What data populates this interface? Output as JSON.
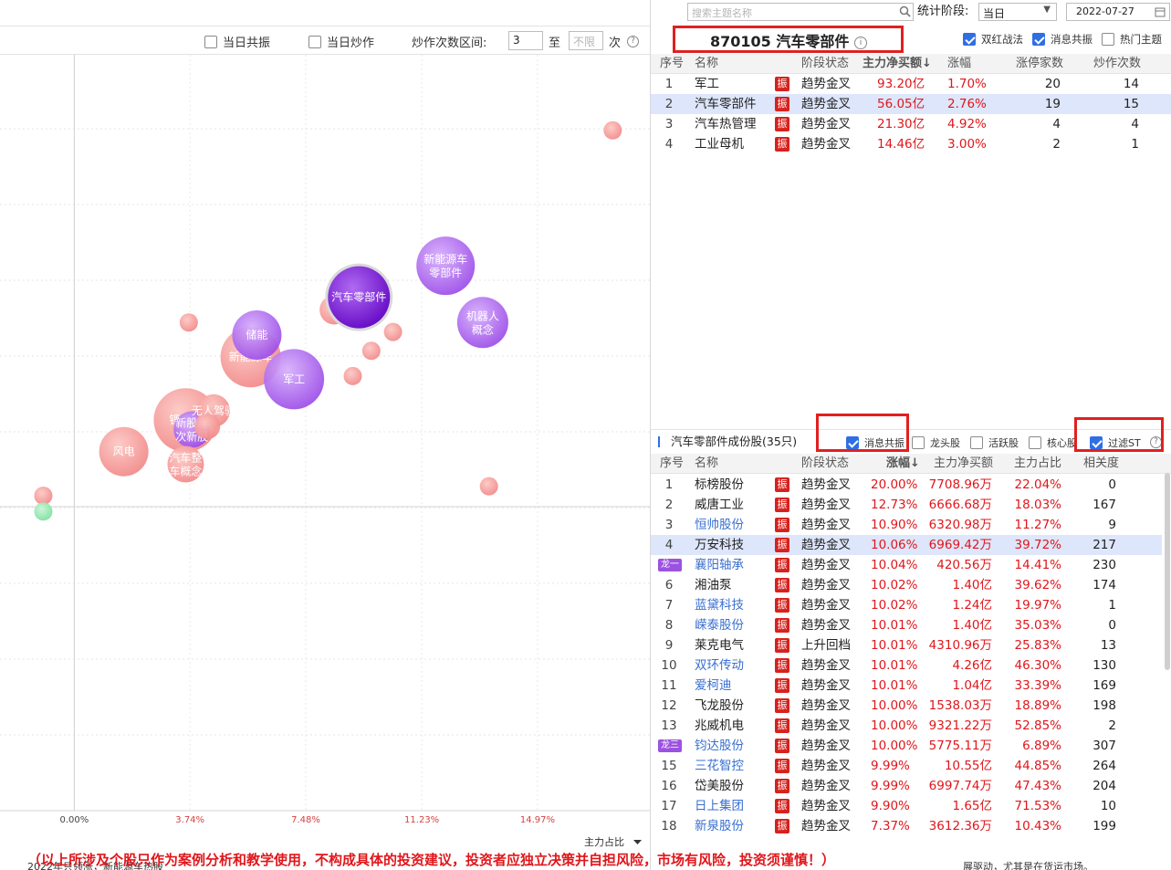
{
  "left_toolbar": {
    "resonance_label": "当日共振",
    "hype_label": "当日炒作",
    "range_label": "炒作次数区间:",
    "range_from": "3",
    "to_label": "至",
    "range_to_placeholder": "不限",
    "unit": "次"
  },
  "search": {
    "placeholder": "搜索主题名称"
  },
  "period": {
    "label": "统计阶段:",
    "value": "当日",
    "date": "2022-07-27"
  },
  "theme_title": "870105 汽车零部件",
  "filters": {
    "shuanghong": "双红战法",
    "xiaoxi": "消息共振",
    "hot": "热门主题"
  },
  "theme_table": {
    "headers": [
      "序号",
      "名称",
      "阶段状态",
      "主力净买额↓",
      "涨幅",
      "涨停家数",
      "炒作次数"
    ],
    "rows": [
      {
        "no": "1",
        "name": "军工",
        "tag": "振",
        "state": "趋势金叉",
        "net": "93.20亿",
        "chg": "1.70%",
        "limit": "20",
        "times": "14"
      },
      {
        "no": "2",
        "name": "汽车零部件",
        "tag": "振",
        "state": "趋势金叉",
        "net": "56.05亿",
        "chg": "2.76%",
        "limit": "19",
        "times": "15"
      },
      {
        "no": "3",
        "name": "汽车热管理",
        "tag": "振",
        "state": "趋势金叉",
        "net": "21.30亿",
        "chg": "4.92%",
        "limit": "4",
        "times": "4"
      },
      {
        "no": "4",
        "name": "工业母机",
        "tag": "振",
        "state": "趋势金叉",
        "net": "14.46亿",
        "chg": "3.00%",
        "limit": "2",
        "times": "1"
      }
    ]
  },
  "stock_section": {
    "title": "汽车零部件成份股(35只)",
    "filters": {
      "xiaoxi": "消息共振",
      "longtou": "龙头股",
      "huoyue": "活跃股",
      "hexin": "核心股",
      "st": "过滤ST"
    },
    "headers": [
      "序号",
      "名称",
      "阶段状态",
      "涨幅↓",
      "主力净买额",
      "主力占比",
      "相关度"
    ]
  },
  "stock_rows": [
    {
      "no": "1",
      "name": "标榜股份",
      "link": false,
      "state": "趋势金叉",
      "chg": "20.00%",
      "net": "7708.96万",
      "ratio": "22.04%",
      "rel": "0"
    },
    {
      "no": "2",
      "name": "威唐工业",
      "link": false,
      "state": "趋势金叉",
      "chg": "12.73%",
      "net": "6666.68万",
      "ratio": "18.03%",
      "rel": "167"
    },
    {
      "no": "3",
      "name": "恒帅股份",
      "link": true,
      "state": "趋势金叉",
      "chg": "10.90%",
      "net": "6320.98万",
      "ratio": "11.27%",
      "rel": "9"
    },
    {
      "no": "4",
      "name": "万安科技",
      "link": false,
      "state": "趋势金叉",
      "chg": "10.06%",
      "net": "6969.42万",
      "ratio": "39.72%",
      "rel": "217",
      "sel": true
    },
    {
      "no": "",
      "badge": "龙一",
      "name": "襄阳轴承",
      "link": true,
      "state": "趋势金叉",
      "chg": "10.04%",
      "net": "420.56万",
      "ratio": "14.41%",
      "rel": "230"
    },
    {
      "no": "6",
      "name": "湘油泵",
      "link": false,
      "state": "趋势金叉",
      "chg": "10.02%",
      "net": "1.40亿",
      "ratio": "39.62%",
      "rel": "174"
    },
    {
      "no": "7",
      "name": "蓝黛科技",
      "link": true,
      "state": "趋势金叉",
      "chg": "10.02%",
      "net": "1.24亿",
      "ratio": "19.97%",
      "rel": "1"
    },
    {
      "no": "8",
      "name": "嵘泰股份",
      "link": true,
      "state": "趋势金叉",
      "chg": "10.01%",
      "net": "1.40亿",
      "ratio": "35.03%",
      "rel": "0"
    },
    {
      "no": "9",
      "name": "莱克电气",
      "link": false,
      "state": "上升回档",
      "chg": "10.01%",
      "net": "4310.96万",
      "ratio": "25.83%",
      "rel": "13"
    },
    {
      "no": "10",
      "name": "双环传动",
      "link": true,
      "state": "趋势金叉",
      "chg": "10.01%",
      "net": "4.26亿",
      "ratio": "46.30%",
      "rel": "130"
    },
    {
      "no": "11",
      "name": "爱柯迪",
      "link": true,
      "state": "趋势金叉",
      "chg": "10.01%",
      "net": "1.04亿",
      "ratio": "33.39%",
      "rel": "169"
    },
    {
      "no": "12",
      "name": "飞龙股份",
      "link": false,
      "state": "趋势金叉",
      "chg": "10.00%",
      "net": "1538.03万",
      "ratio": "18.89%",
      "rel": "198"
    },
    {
      "no": "13",
      "name": "兆威机电",
      "link": false,
      "state": "趋势金叉",
      "chg": "10.00%",
      "net": "9321.22万",
      "ratio": "52.85%",
      "rel": "2"
    },
    {
      "no": "",
      "badge": "龙三",
      "name": "钧达股份",
      "link": true,
      "state": "趋势金叉",
      "chg": "10.00%",
      "net": "5775.11万",
      "ratio": "6.89%",
      "rel": "307"
    },
    {
      "no": "15",
      "name": "三花智控",
      "link": true,
      "state": "趋势金叉",
      "chg": "9.99%",
      "net": "10.55亿",
      "ratio": "44.85%",
      "rel": "264"
    },
    {
      "no": "16",
      "name": "岱美股份",
      "link": false,
      "state": "趋势金叉",
      "chg": "9.99%",
      "net": "6997.74万",
      "ratio": "47.43%",
      "rel": "204"
    },
    {
      "no": "17",
      "name": "日上集团",
      "link": true,
      "state": "趋势金叉",
      "chg": "9.90%",
      "net": "1.65亿",
      "ratio": "71.53%",
      "rel": "10"
    },
    {
      "no": "18",
      "name": "新泉股份",
      "link": true,
      "state": "趋势金叉",
      "chg": "7.37%",
      "net": "3612.36万",
      "ratio": "10.43%",
      "rel": "199"
    }
  ],
  "zhen_label": "振",
  "disclaimer": "（以上所涉及个股只作为案例分析和教学使用，不构成具体的投资建议，投资者应独立决策并自担风险，市场有风险，投资须谨慎！）",
  "background_text": "2022年只领涨，新能源车热股",
  "background_text_end": "展驱动，尤其是在货运市场。",
  "chart_data": {
    "type": "scatter",
    "xlabel": "主力占比",
    "x_ticks": [
      "0.00%",
      "3.74%",
      "7.48%",
      "11.23%",
      "14.97%"
    ],
    "x_tick_values": [
      0,
      3.74,
      7.48,
      11.23,
      14.97
    ],
    "xlim": [
      -2.4,
      18.6
    ],
    "ylim": [
      -10,
      14
    ],
    "colors": {
      "purple": "#9d4fe8",
      "pink": "#f28a8a",
      "green": "#7fe0a0"
    },
    "points": [
      {
        "label": "",
        "x": 17.4,
        "y": 11.6,
        "r": 10,
        "color": "pink"
      },
      {
        "label": "新能源车零部件",
        "x": 12.0,
        "y": 7.3,
        "r": 32,
        "color": "purple"
      },
      {
        "label": "汽车零部件",
        "x": 9.2,
        "y": 6.3,
        "r": 34,
        "color": "purple",
        "highlight": true
      },
      {
        "label": "",
        "x": 8.4,
        "y": 5.9,
        "r": 16,
        "color": "pink"
      },
      {
        "label": "机器人概念",
        "x": 13.2,
        "y": 5.5,
        "r": 28,
        "color": "purple"
      },
      {
        "label": "",
        "x": 3.7,
        "y": 5.5,
        "r": 10,
        "color": "pink"
      },
      {
        "label": "储能",
        "x": 5.9,
        "y": 5.1,
        "r": 27,
        "color": "purple"
      },
      {
        "label": "新能源车",
        "x": 5.7,
        "y": 4.4,
        "r": 33,
        "color": "pink"
      },
      {
        "label": "",
        "x": 10.3,
        "y": 5.2,
        "r": 10,
        "color": "pink"
      },
      {
        "label": "",
        "x": 9.6,
        "y": 4.6,
        "r": 10,
        "color": "pink"
      },
      {
        "label": "军工",
        "x": 7.1,
        "y": 3.7,
        "r": 33,
        "color": "purple"
      },
      {
        "label": "",
        "x": 9.0,
        "y": 3.8,
        "r": 10,
        "color": "pink"
      },
      {
        "label": "无人驾驶",
        "x": 4.5,
        "y": 2.7,
        "r": 18,
        "color": "pink"
      },
      {
        "label": "锂电池",
        "x": 3.6,
        "y": 2.4,
        "r": 35,
        "color": "pink"
      },
      {
        "label": "",
        "x": 4.3,
        "y": 2.2,
        "r": 14,
        "color": "pink"
      },
      {
        "label": "新股与次新股",
        "x": 3.8,
        "y": 2.1,
        "r": 20,
        "color": "purple"
      },
      {
        "label": "风电",
        "x": 1.6,
        "y": 1.4,
        "r": 27,
        "color": "pink"
      },
      {
        "label": "汽车整车概念",
        "x": 3.6,
        "y": 1.0,
        "r": 20,
        "color": "pink"
      },
      {
        "label": "",
        "x": 13.4,
        "y": 0.3,
        "r": 10,
        "color": "pink"
      },
      {
        "label": "",
        "x": -1.0,
        "y": 0.0,
        "r": 10,
        "color": "pink"
      },
      {
        "label": "",
        "x": -1.0,
        "y": -0.5,
        "r": 10,
        "color": "green"
      }
    ]
  }
}
